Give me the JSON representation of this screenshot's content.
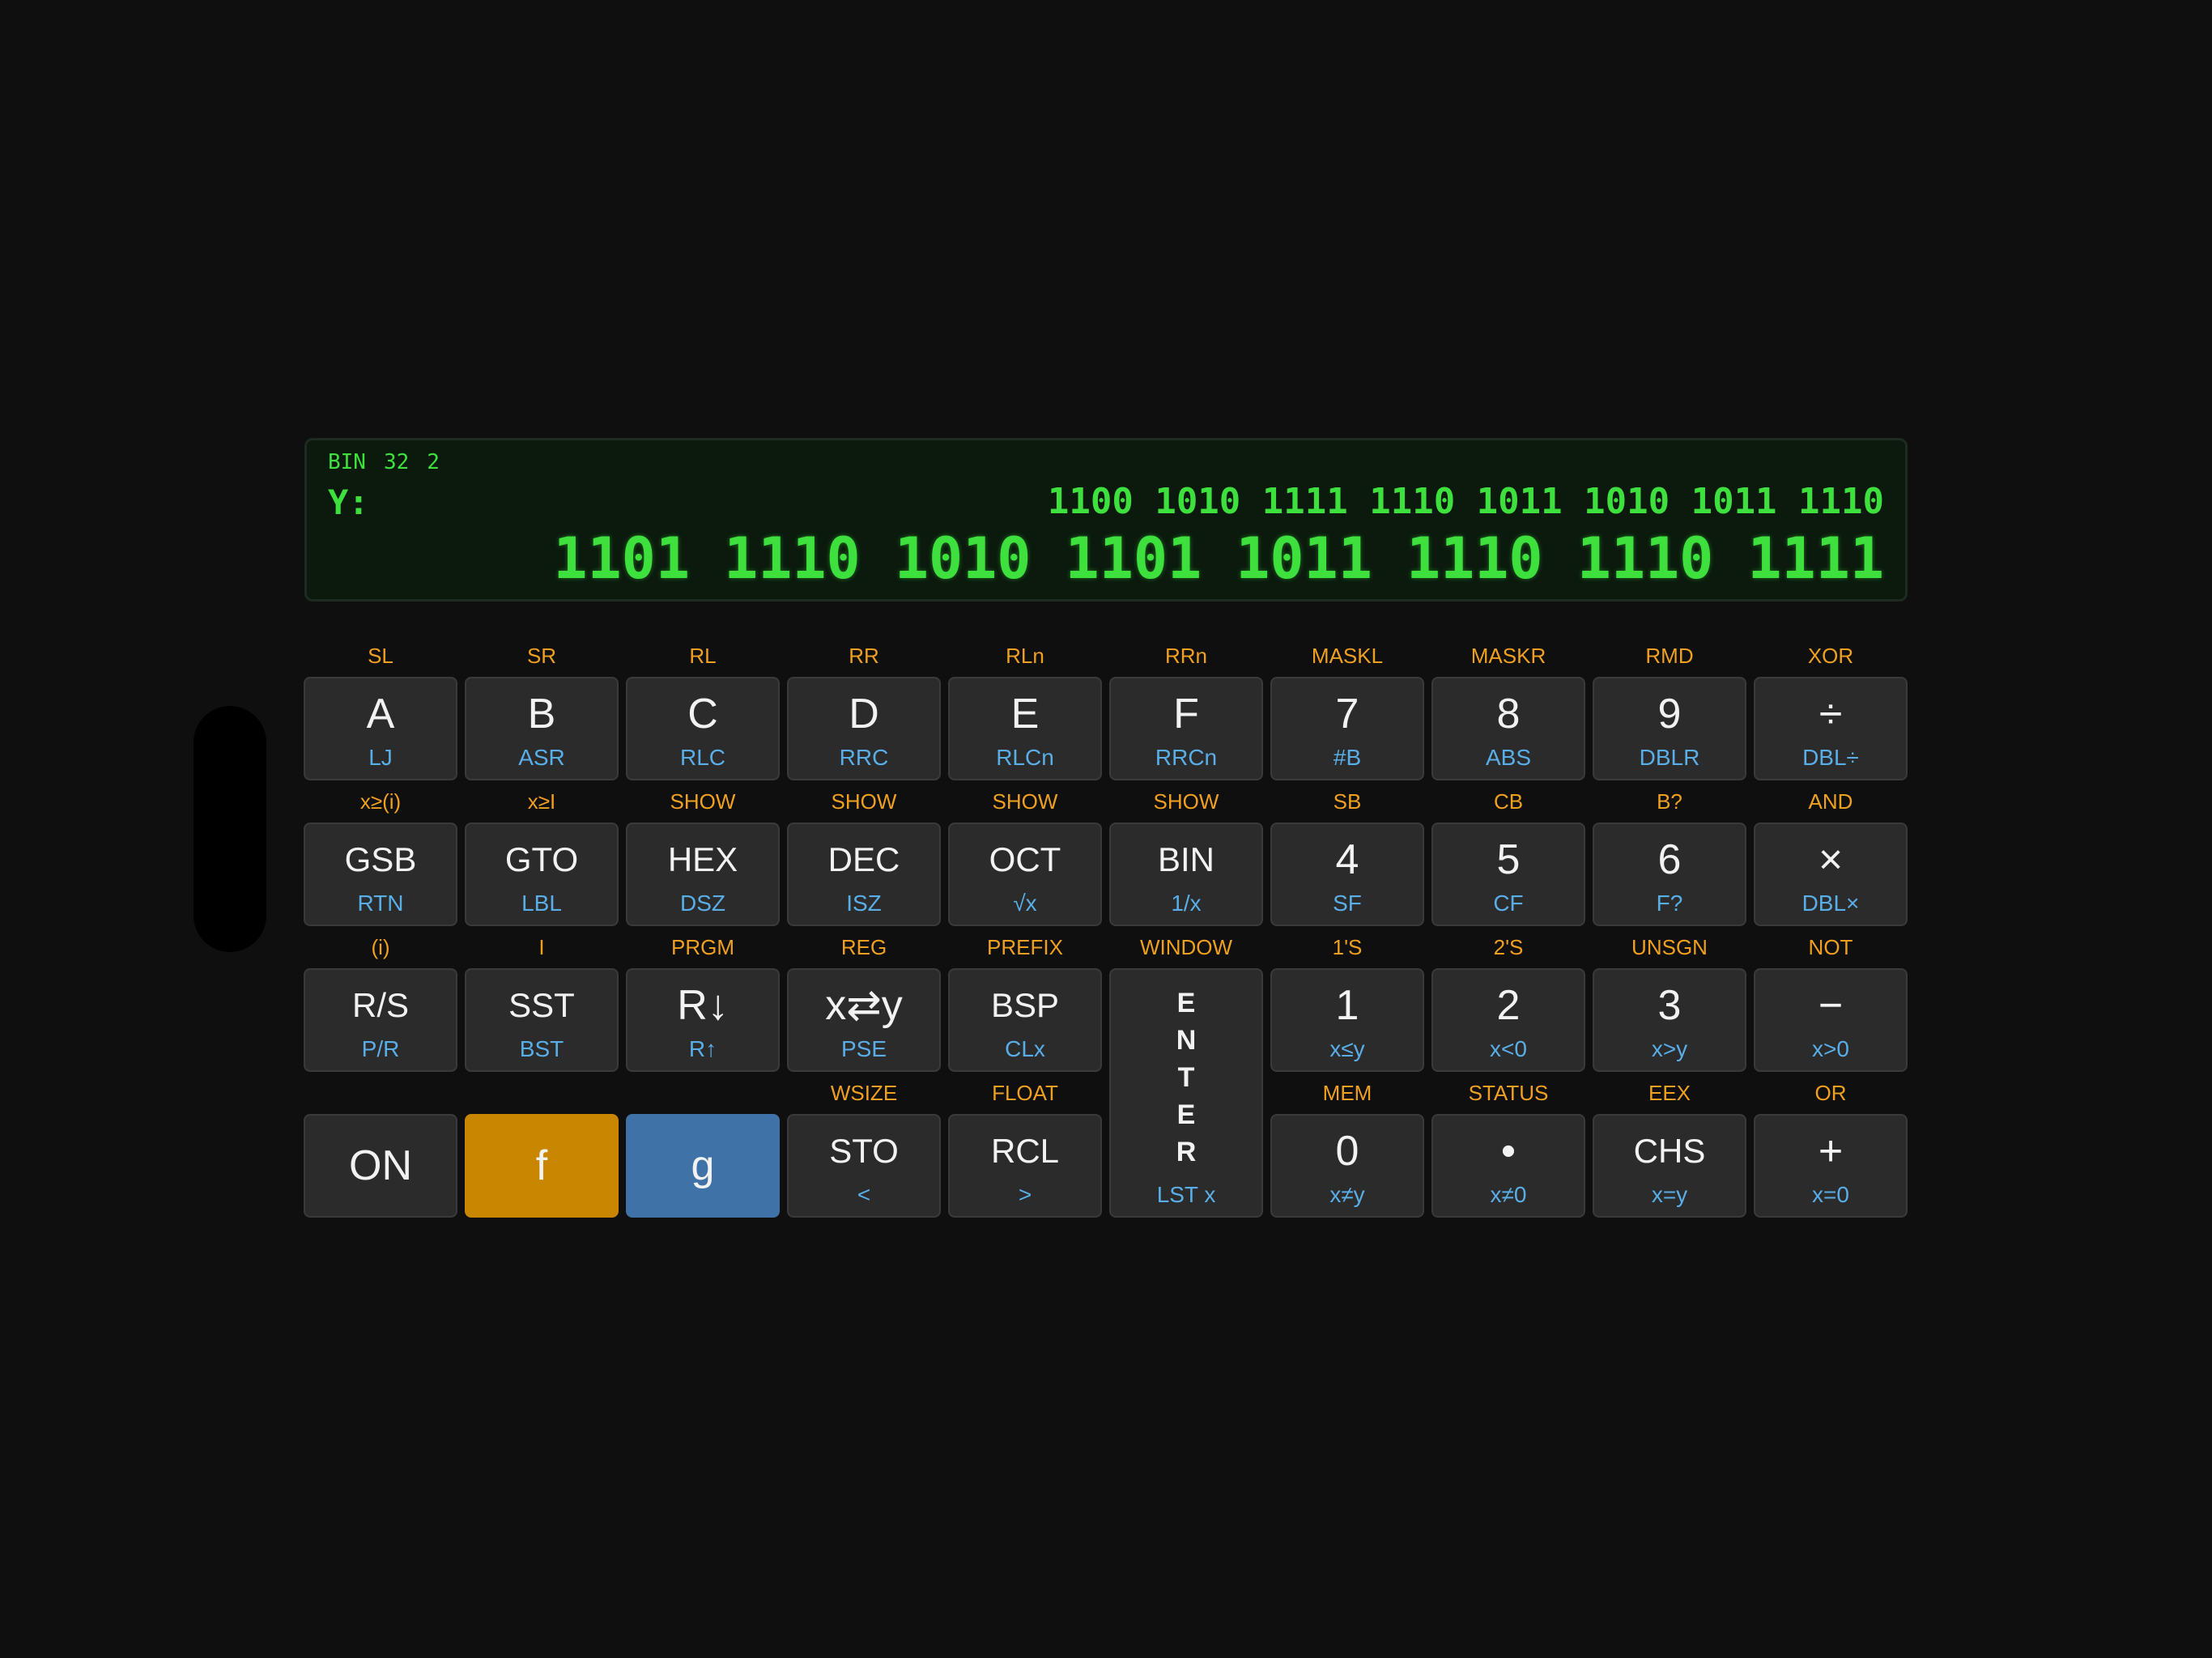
{
  "display": {
    "mode": "BIN",
    "word_size": "32",
    "complement": "2",
    "y_label": "Y:",
    "y_value": "1100 1010 1111 1110 1011 1010 1011 1110",
    "x_value": "1101 1110 1010 1101 1011 1110 1110 1111"
  },
  "rows": [
    {
      "keys": [
        {
          "f": "SL",
          "main": "A",
          "g": "LJ"
        },
        {
          "f": "SR",
          "main": "B",
          "g": "ASR"
        },
        {
          "f": "RL",
          "main": "C",
          "g": "RLC"
        },
        {
          "f": "RR",
          "main": "D",
          "g": "RRC"
        },
        {
          "f": "RLn",
          "main": "E",
          "g": "RLCn"
        },
        {
          "f": "RRn",
          "main": "F",
          "g": "RRCn"
        },
        {
          "f": "MASKL",
          "main": "7",
          "g": "#B"
        },
        {
          "f": "MASKR",
          "main": "8",
          "g": "ABS"
        },
        {
          "f": "RMD",
          "main": "9",
          "g": "DBLR"
        },
        {
          "f": "XOR",
          "main": "÷",
          "g": "DBL÷"
        }
      ]
    },
    {
      "keys": [
        {
          "f": "x≥(i)",
          "main": "GSB",
          "g": "RTN"
        },
        {
          "f": "x≥I",
          "main": "GTO",
          "g": "LBL"
        },
        {
          "f": "SHOW",
          "main": "HEX",
          "g": "DSZ"
        },
        {
          "f": "SHOW",
          "main": "DEC",
          "g": "ISZ"
        },
        {
          "f": "SHOW",
          "main": "OCT",
          "g": "√x"
        },
        {
          "f": "SHOW",
          "main": "BIN",
          "g": "1/x"
        },
        {
          "f": "SB",
          "main": "4",
          "g": "SF"
        },
        {
          "f": "CB",
          "main": "5",
          "g": "CF"
        },
        {
          "f": "B?",
          "main": "6",
          "g": "F?"
        },
        {
          "f": "AND",
          "main": "×",
          "g": "DBL×"
        }
      ]
    },
    {
      "keys": [
        {
          "f": "(i)",
          "main": "R/S",
          "g": "P/R"
        },
        {
          "f": "I",
          "main": "SST",
          "g": "BST"
        },
        {
          "f": "PRGM",
          "main": "R↓",
          "g": "R↑"
        },
        {
          "f": "REG",
          "main": "x⇄y",
          "g": "PSE"
        },
        {
          "f": "PREFIX",
          "main": "BSP",
          "g": "CLx"
        },
        {
          "f": "WINDOW",
          "main": "ENTER",
          "g": "LST x"
        },
        {
          "f": "1'S",
          "main": "1",
          "g": "x≤y"
        },
        {
          "f": "2'S",
          "main": "2",
          "g": "x<0"
        },
        {
          "f": "UNSGN",
          "main": "3",
          "g": "x>y"
        },
        {
          "f": "NOT",
          "main": "−",
          "g": "x>0"
        }
      ]
    },
    {
      "keys": [
        {
          "f": "",
          "main": "ON",
          "g": ""
        },
        {
          "f": "",
          "main": "f",
          "g": ""
        },
        {
          "f": "",
          "main": "g",
          "g": ""
        },
        {
          "f": "WSIZE",
          "main": "STO",
          "g": "<"
        },
        {
          "f": "FLOAT",
          "main": "RCL",
          "g": ">"
        },
        {
          "f": "",
          "main": "",
          "g": ""
        },
        {
          "f": "MEM",
          "main": "0",
          "g": "x≠y"
        },
        {
          "f": "STATUS",
          "main": "•",
          "g": "x≠0"
        },
        {
          "f": "EEX",
          "main": "CHS",
          "g": "x=y"
        },
        {
          "f": "OR",
          "main": "+",
          "g": "x=0"
        }
      ]
    }
  ],
  "enter_letters": [
    "E",
    "N",
    "T",
    "E",
    "R"
  ],
  "colors": {
    "background": "#0f0f0f",
    "display_text": "#3ee03e",
    "f_label": "#f0a020",
    "g_label": "#5aaee8",
    "f_key": "#c98600",
    "g_key": "#3f73a8",
    "key": "#2b2b2b"
  }
}
